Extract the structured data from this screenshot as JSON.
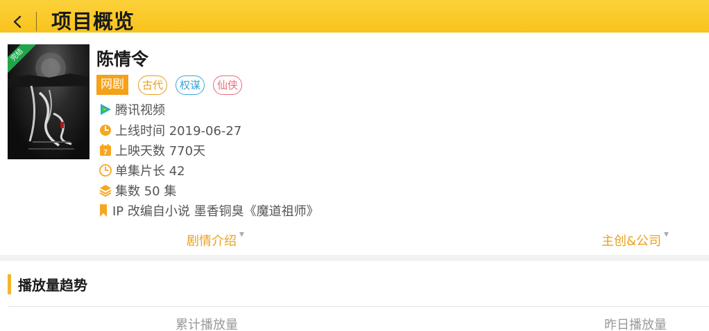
{
  "header": {
    "title": "项目概览",
    "back_icon": "chevron-left-icon"
  },
  "project": {
    "title": "陈情令",
    "status_ribbon": "完结",
    "type_tag": "网剧",
    "genre_tags": [
      "古代",
      "权谋",
      "仙侠"
    ],
    "platform": "腾讯视频",
    "release_date": "上线时间 2019-06-27",
    "days_running": "上映天数 770天",
    "episode_length": "单集片长 42",
    "episode_count": "集数 50 集",
    "ip_source": "IP 改编自小说 墨香铜臭《魔道祖师》"
  },
  "links": {
    "synopsis": "剧情介绍",
    "crew": "主创&公司"
  },
  "section": {
    "title": "播放量趋势"
  },
  "stats": {
    "total_label": "累计播放量",
    "yesterday_label": "昨日播放量"
  },
  "colors": {
    "header_yellow": "#f8c21c",
    "accent_orange": "#f5a11a",
    "tag_blue": "#3aa8d8",
    "tag_pink": "#e96b7a",
    "ribbon_green": "#1fa64a"
  }
}
